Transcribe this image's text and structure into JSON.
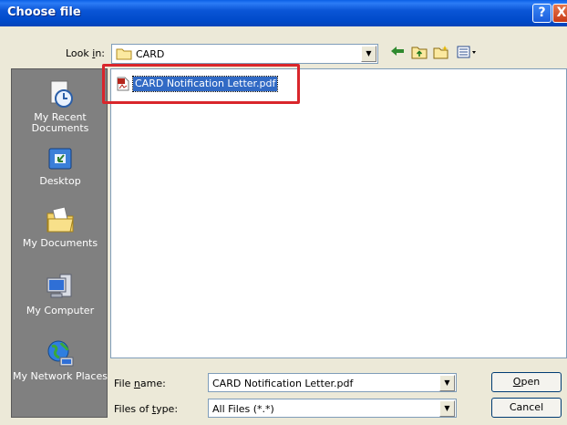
{
  "window": {
    "title": "Choose file",
    "help_glyph": "?",
    "close_glyph": "X"
  },
  "lookin": {
    "label_pre": "Look ",
    "label_accel": "i",
    "label_post": "n:",
    "value": "CARD"
  },
  "toolbar": {
    "back_icon": "back-arrow-icon",
    "up_icon": "up-folder-icon",
    "new_folder_icon": "new-folder-icon",
    "views_icon": "views-menu-icon"
  },
  "places": [
    {
      "label": "My Recent Documents",
      "icon": "recent-documents-icon"
    },
    {
      "label": "Desktop",
      "icon": "desktop-icon"
    },
    {
      "label": "My Documents",
      "icon": "my-documents-icon"
    },
    {
      "label": "My Computer",
      "icon": "my-computer-icon"
    },
    {
      "label": "My Network Places",
      "icon": "network-places-icon"
    }
  ],
  "files": [
    {
      "name": "CARD Notification Letter.pdf",
      "icon": "pdf-file-icon",
      "selected": true
    }
  ],
  "filename": {
    "label_pre": "File ",
    "label_accel": "n",
    "label_post": "ame:",
    "value": "CARD Notification Letter.pdf"
  },
  "filetype": {
    "label_pre": "Files of ",
    "label_accel": "t",
    "label_post": "ype:",
    "value": "All Files (*.*)"
  },
  "buttons": {
    "open_accel": "O",
    "open_rest": "pen",
    "cancel": "Cancel"
  },
  "colors": {
    "title_bar": "#0a55d6",
    "selection": "#316ac5",
    "highlight_annotation": "#d9262b",
    "places_bar": "#808080"
  }
}
